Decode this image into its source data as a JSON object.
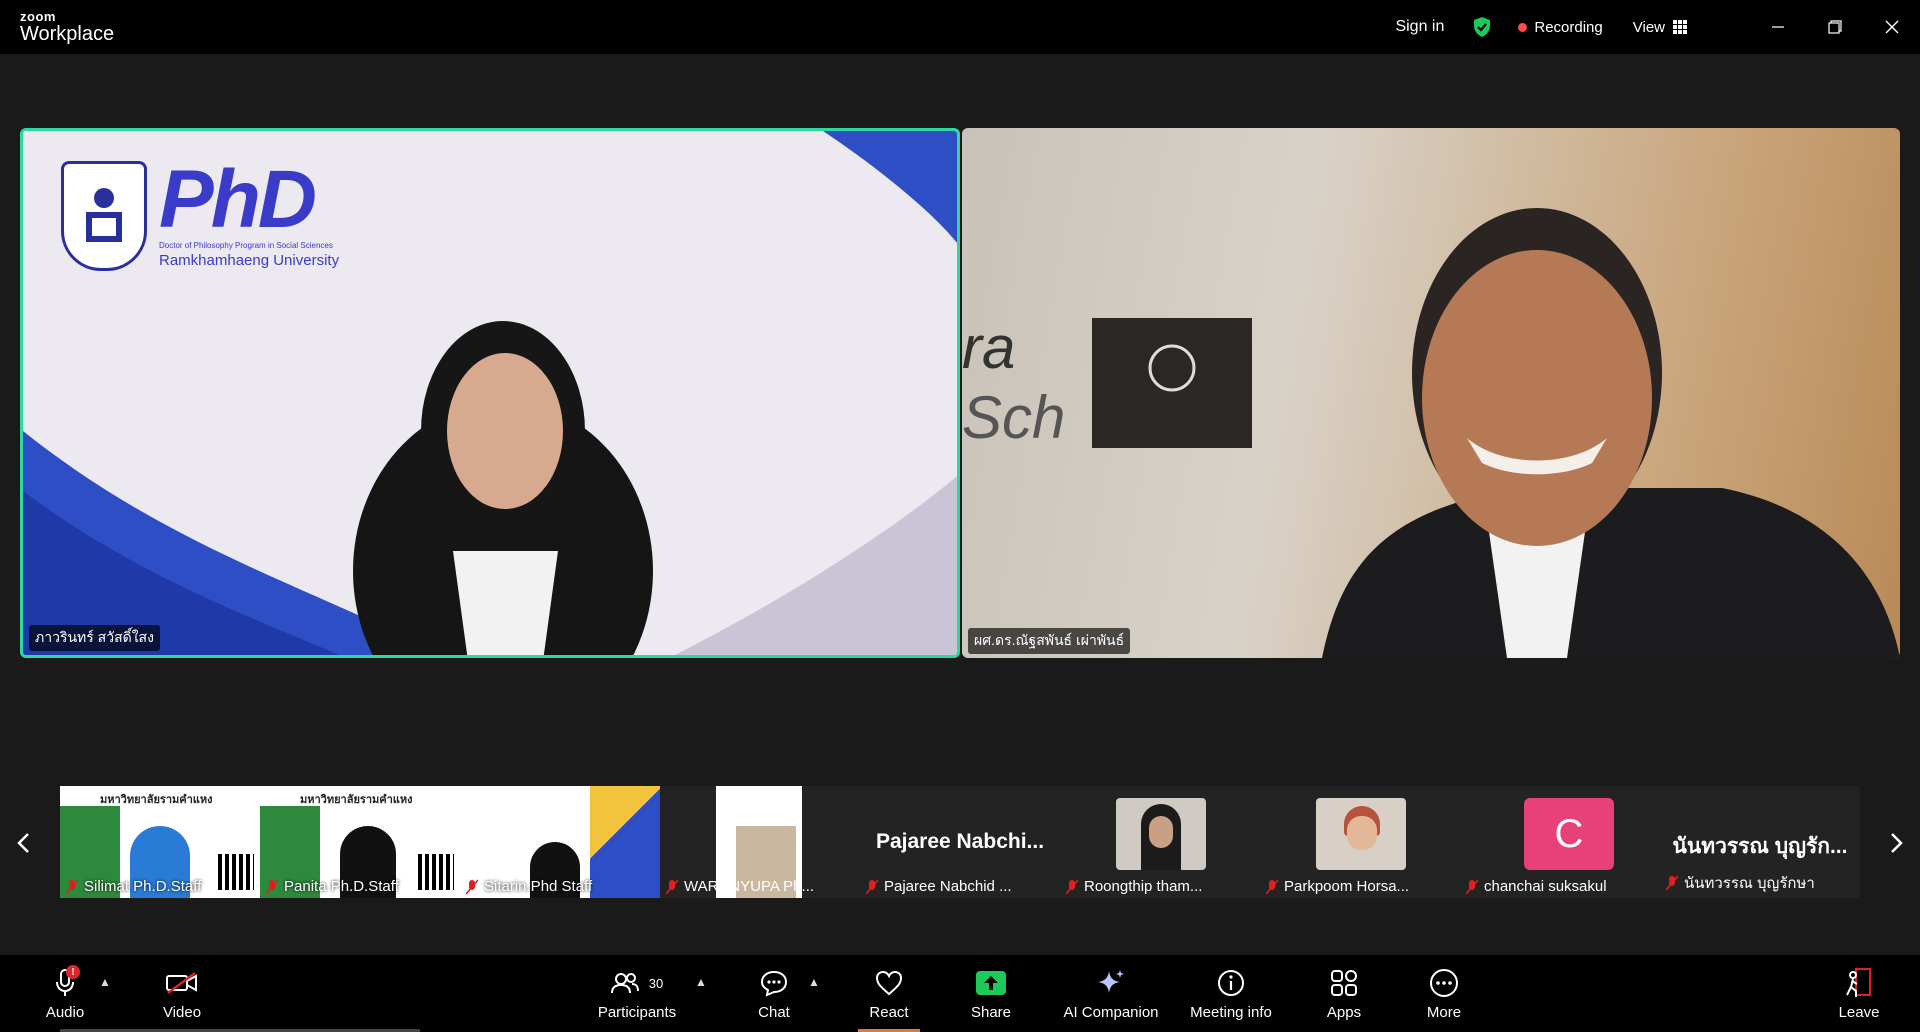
{
  "app": {
    "brand_small": "zoom",
    "brand_large": "Workplace"
  },
  "topbar": {
    "signin": "Sign in",
    "recording": "Recording",
    "view": "View"
  },
  "colors": {
    "active_speaker_border": "#2ed8a3",
    "record_dot": "#ff4d4d",
    "share_green": "#1ec95b",
    "badge_red": "#e0262b",
    "avatar_c": "#e8417a"
  },
  "main_tiles": [
    {
      "name": "ภาวรินทร์ สวัสดิ์ใสง"
    },
    {
      "name": "ผศ.ดร.ณัฐสพันธ์ เผ่าพันธ์"
    }
  ],
  "phd_slide": {
    "big": "PhD",
    "sub1": "Doctor of Philosophy Program in Social Sciences",
    "sub2": "Ramkhamhaeng University"
  },
  "thumbnails": [
    {
      "label": "Silimat Ph.D.Staff"
    },
    {
      "label": "Panita Ph.D.Staff"
    },
    {
      "label": "Sitarin.Phd Staff"
    },
    {
      "label": "WARUNYUPA Ph..."
    },
    {
      "label": "Pajaree Nabchid ...",
      "big_name": "Pajaree  Nabchi..."
    },
    {
      "label": "Roongthip tham..."
    },
    {
      "label": "Parkpoom Horsa..."
    },
    {
      "label": "chanchai suksakul",
      "avatar_letter": "C"
    },
    {
      "label": "นันทวรรณ บุญรักษา",
      "big_name": "นันทวรรณ บุญรัก..."
    }
  ],
  "slide_header": "มหาวิทยาลัยรามคำแหง",
  "toolbar": {
    "audio": "Audio",
    "audio_badge": "!",
    "video": "Video",
    "participants": "Participants",
    "participants_count": "30",
    "chat": "Chat",
    "react": "React",
    "share": "Share",
    "ai_companion": "AI Companion",
    "meeting_info": "Meeting info",
    "apps": "Apps",
    "more": "More",
    "leave": "Leave"
  }
}
